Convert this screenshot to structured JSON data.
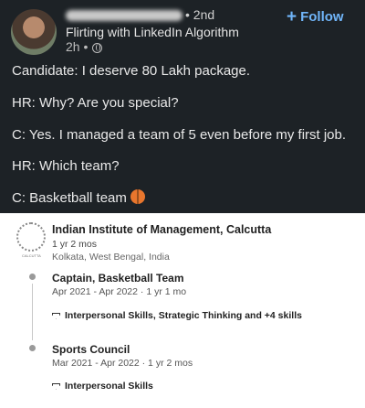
{
  "post": {
    "degree": "• 2nd",
    "headline": "Flirting with LinkedIn Algorithm",
    "time": "2h •",
    "follow_label": "Follow",
    "lines": [
      "Candidate: I deserve 80 Lakh package.",
      "HR: Why? Are you special?",
      "C: Yes. I managed a team of 5 even before my first job.",
      "HR: Which team?",
      "C: Basketball team"
    ],
    "icons": [
      "globe-icon",
      "plus-icon",
      "basketball-icon"
    ]
  },
  "experience": {
    "institution": "Indian Institute of Management, Calcutta",
    "logo_caption": "CALCUTTA",
    "duration": "1 yr 2 mos",
    "location": "Kolkata, West Bengal, India",
    "roles": [
      {
        "title": "Captain, Basketball Team",
        "dates": "Apr 2021 - Apr 2022 · 1 yr 1 mo",
        "skills": "Interpersonal Skills, Strategic Thinking and +4 skills"
      },
      {
        "title": "Sports Council",
        "dates": "Mar 2021 - Apr 2022 · 1 yr 2 mos",
        "skills": "Interpersonal Skills"
      }
    ]
  },
  "colors": {
    "dark_bg": "#1d2226",
    "accent": "#70b5f9",
    "card_bg": "#ffffff"
  }
}
